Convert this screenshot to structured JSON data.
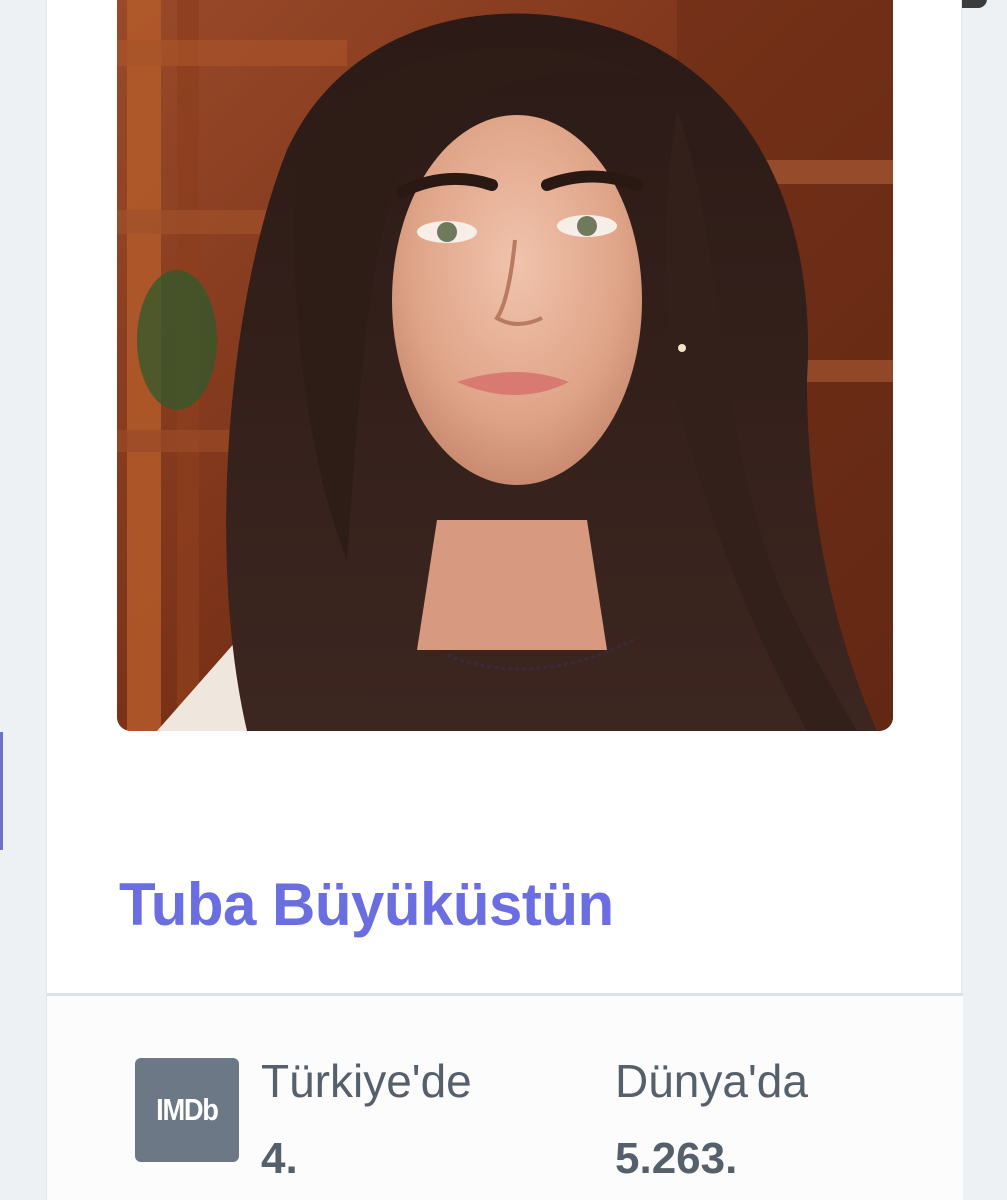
{
  "profile": {
    "name": "Tuba Büyüküstün",
    "photo_subject": "portrait of Tuba Büyüküstün"
  },
  "imdb": {
    "logo_text": "IMDb",
    "stats": [
      {
        "label": "Türkiye'de",
        "value": "4."
      },
      {
        "label": "Dünya'da",
        "value": "5.263."
      }
    ]
  },
  "colors": {
    "name_link": "#6b6ee0",
    "imdb_badge": "#6c7886",
    "stat_text": "#56606b",
    "page_bg": "#eef1f3"
  }
}
